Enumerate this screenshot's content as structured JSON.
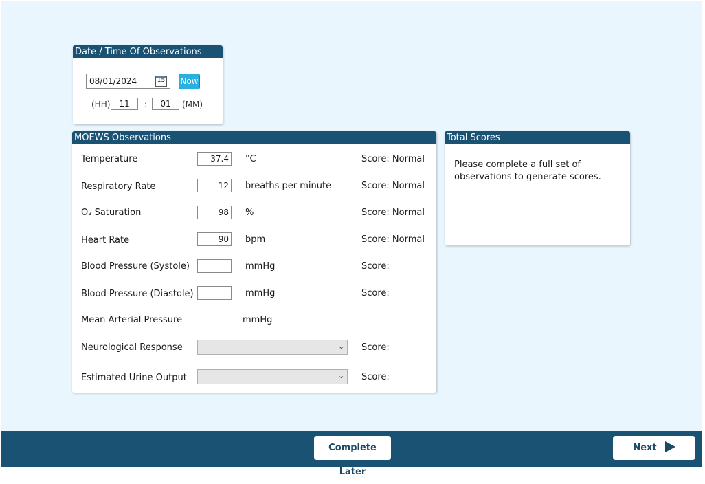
{
  "datetime_panel": {
    "title": "Date / Time Of Observations",
    "date_value": "08/01/2024",
    "calendar_icon": "calendar-icon",
    "calendar_day": "15",
    "now_label": "Now",
    "hh_label": "(HH)",
    "hour_value": "11",
    "separator": ":",
    "minute_value": "01",
    "mm_label": "(MM)"
  },
  "observations": {
    "title": "MOEWS Observations",
    "rows": [
      {
        "label": "Temperature",
        "value": "37.4",
        "unit": "°C",
        "score": "Score: Normal"
      },
      {
        "label": "Respiratory Rate",
        "value": "12",
        "unit": "breaths per minute",
        "score": "Score: Normal"
      },
      {
        "label": "O₂ Saturation",
        "value": "98",
        "unit": "%",
        "score": "Score: Normal"
      },
      {
        "label": "Heart Rate",
        "value": "90",
        "unit": "bpm",
        "score": "Score: Normal"
      },
      {
        "label": "Blood Pressure (Systole)",
        "value": "",
        "unit": "mmHg",
        "score": "Score:"
      },
      {
        "label": "Blood Pressure (Diastole)",
        "value": "",
        "unit": "mmHg",
        "score": "Score:"
      },
      {
        "label": "Mean Arterial Pressure",
        "unit": "mmHg"
      },
      {
        "label": "Neurological Response",
        "selected": "",
        "score": "Score:"
      },
      {
        "label": "Estimated Urine Output",
        "selected": "",
        "score": "Score:"
      }
    ]
  },
  "total_scores": {
    "title": "Total Scores",
    "message": "Please complete a full set of observations to generate scores."
  },
  "footer": {
    "complete_later_label": "Complete Later",
    "next_label": "Next",
    "next_icon": "play-icon"
  },
  "colors": {
    "header_bg": "#1a5274",
    "page_bg": "#eaf6fd",
    "now_button": "#2ab0de"
  }
}
